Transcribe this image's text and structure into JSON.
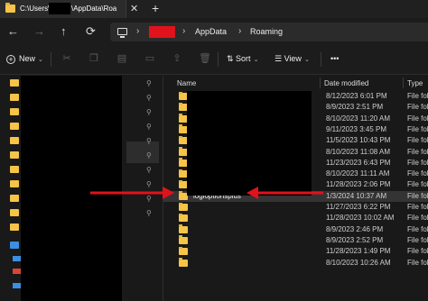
{
  "window": {
    "tab_title_prefix": "C:\\Users\\",
    "tab_title_suffix": "\\AppData\\Roa",
    "tab_close": "✕",
    "new_tab": "+"
  },
  "nav": {
    "back": "←",
    "forward": "→",
    "up": "↑",
    "refresh": "⟳"
  },
  "address": {
    "sep": "›",
    "crumbs": [
      "AppData",
      "Roaming"
    ]
  },
  "commands": {
    "new_label": "New",
    "sort_label": "Sort",
    "view_label": "View",
    "more_label": "•••",
    "caret": "⌄"
  },
  "columns": {
    "name": "Name",
    "date": "Date modified",
    "type": "Type"
  },
  "files": [
    {
      "name": "",
      "date": "8/12/2023 6:01 PM",
      "type": "File fold"
    },
    {
      "name": "",
      "date": "8/9/2023 2:51 PM",
      "type": "File fold"
    },
    {
      "name": "",
      "date": "8/10/2023 11:20 AM",
      "type": "File fold"
    },
    {
      "name": "",
      "date": "9/11/2023 3:45 PM",
      "type": "File fold"
    },
    {
      "name": "",
      "date": "11/5/2023 10:43 PM",
      "type": "File fold"
    },
    {
      "name": "",
      "date": "8/10/2023 11:08 AM",
      "type": "File fold"
    },
    {
      "name": "",
      "date": "11/23/2023 6:43 PM",
      "type": "File fold"
    },
    {
      "name": "",
      "date": "8/10/2023 11:11 AM",
      "type": "File fold"
    },
    {
      "name": "",
      "date": "11/28/2023 2:06 PM",
      "type": "File fold"
    },
    {
      "name": "logioptionsplus",
      "date": "1/3/2024 10:37 AM",
      "type": "File fold"
    },
    {
      "name": "",
      "date": "11/27/2023 6:22 PM",
      "type": "File fold"
    },
    {
      "name": "",
      "date": "11/28/2023 10:02 AM",
      "type": "File fold"
    },
    {
      "name": "",
      "date": "8/9/2023 2:46 PM",
      "type": "File fold"
    },
    {
      "name": "",
      "date": "8/9/2023 2:52 PM",
      "type": "File fold"
    },
    {
      "name": "",
      "date": "11/28/2023 1:49 PM",
      "type": "File fold"
    },
    {
      "name": "",
      "date": "8/10/2023 10:26 AM",
      "type": "File fold"
    }
  ],
  "colors": {
    "folder": "#f5c448",
    "arrow": "#e0121b",
    "background": "#191919"
  }
}
